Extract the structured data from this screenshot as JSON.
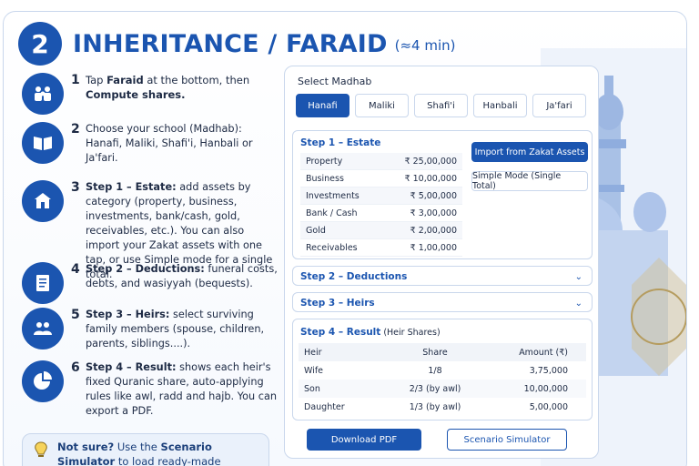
{
  "header": {
    "number": "2",
    "title": "INHERITANCE / FARAID",
    "subtitle": "(≈4 min)"
  },
  "steps": [
    {
      "num": "1",
      "icon": "family-icon",
      "parts": [
        [
          "",
          "Tap "
        ],
        [
          "b",
          "Faraid"
        ],
        [
          "",
          " at the bottom, then "
        ],
        [
          "b",
          "Compute shares."
        ]
      ]
    },
    {
      "num": "2",
      "icon": "book-icon",
      "parts": [
        [
          "",
          "Choose your school (Madhab): Hanafi, Maliki, Shafi'i, Hanbali or Ja'fari."
        ]
      ]
    },
    {
      "num": "3",
      "icon": "house-icon",
      "parts": [
        [
          "b",
          "Step 1 – Estate:"
        ],
        [
          "",
          " add assets by category (property, business, investments, bank/cash, gold, receivables, etc.). You can also import your Zakat assets with one tap, or use Simple mode for a single total."
        ]
      ]
    },
    {
      "num": "4",
      "icon": "document-icon",
      "parts": [
        [
          "b",
          "Step 2 – Deductions:"
        ],
        [
          "",
          " funeral costs, debts, and wasiyyah (bequests)."
        ]
      ]
    },
    {
      "num": "5",
      "icon": "people-icon",
      "parts": [
        [
          "b",
          "Step 3 – Heirs:"
        ],
        [
          "",
          " select surviving family members (spouse, children, parents, siblings....)."
        ]
      ]
    },
    {
      "num": "6",
      "icon": "pie-chart-icon",
      "parts": [
        [
          "b",
          "Step 4 – Result:"
        ],
        [
          "",
          " shows each heir's fixed Quranic share, auto-applying rules like awl, radd and hajb. You can export a PDF."
        ]
      ]
    }
  ],
  "tip": {
    "strong": "Not sure?",
    "text": " Use the ",
    "link": "Scenario Simulator",
    "text2": " to load ready-made textbook cases."
  },
  "panel": {
    "madhab_label": "Select Madhab",
    "madhabs": [
      "Hanafi",
      "Maliki",
      "Shafi'i",
      "Hanbali",
      "Ja'fari"
    ],
    "active_madhab": 0,
    "estate": {
      "title": "Step 1 – Estate",
      "rows": [
        {
          "label": "Property",
          "value": "₹ 25,00,000"
        },
        {
          "label": "Business",
          "value": "₹ 10,00,000"
        },
        {
          "label": "Investments",
          "value": "₹ 5,00,000"
        },
        {
          "label": "Bank / Cash",
          "value": "₹ 3,00,000"
        },
        {
          "label": "Gold",
          "value": "₹ 2,00,000"
        },
        {
          "label": "Receivables",
          "value": "₹ 1,00,000"
        }
      ],
      "import_label": "Import from Zakat Assets",
      "simple_label": "Simple Mode (Single Total)"
    },
    "deductions_title": "Step 2 – Deductions",
    "heirs_title": "Step 3 – Heirs",
    "result": {
      "title": "Step 4 – Result",
      "title_suffix": " (Heir Shares)",
      "headers": [
        "Heir",
        "Share",
        "Amount (₹)"
      ],
      "rows": [
        [
          "Wife",
          "1/8",
          "3,75,000"
        ],
        [
          "Son",
          "2/3 (by awl)",
          "10,00,000"
        ],
        [
          "Daughter",
          "1/3 (by awl)",
          "5,00,000"
        ]
      ]
    },
    "download_label": "Download PDF",
    "simulator_label": "Scenario Simulator"
  }
}
